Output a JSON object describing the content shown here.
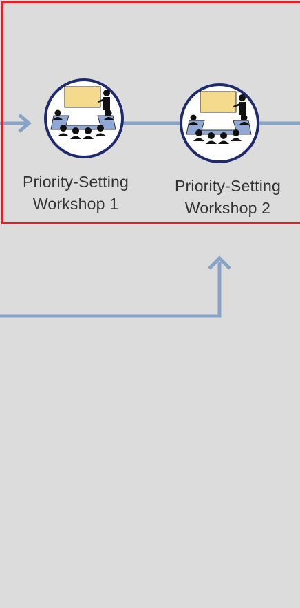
{
  "nodes": [
    {
      "icon": "workshop-presentation-icon",
      "label_line1": "Priority-Setting",
      "label_line2": "Workshop 1"
    },
    {
      "icon": "workshop-presentation-icon",
      "label_line1": "Priority-Setting",
      "label_line2": "Workshop 2"
    }
  ],
  "colors": {
    "background": "#dcdcdc",
    "connector": "#87a3c8",
    "highlight": "#e41e26",
    "circle_border": "#1e2a6e",
    "screen": "#f5d98c",
    "table": "#8fa8d6",
    "people": "#111111",
    "label_text": "#333333"
  }
}
